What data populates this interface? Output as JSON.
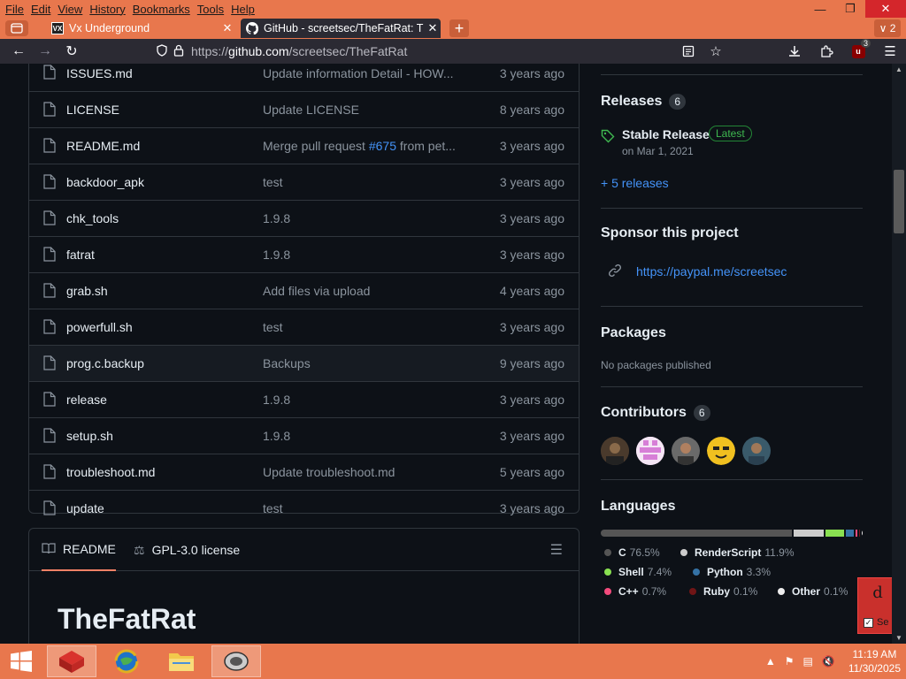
{
  "menubar": {
    "items": [
      "File",
      "Edit",
      "View",
      "History",
      "Bookmarks",
      "Tools",
      "Help"
    ]
  },
  "tabs": [
    {
      "title": "Vx Underground",
      "icon": "vx-favicon",
      "favicon_text": "VX"
    },
    {
      "title": "GitHub - screetsec/TheFatRat: T",
      "icon": "github-icon"
    }
  ],
  "tab_count": "2",
  "url": {
    "prefix": "https://",
    "domain": "github.com",
    "path": "/screetsec/TheFatRat"
  },
  "extension_badge": "3",
  "ublock_label": "u",
  "files": [
    {
      "name": "ISSUES.md",
      "message": "Update information Detail - HOW...",
      "time": "3 years ago"
    },
    {
      "name": "LICENSE",
      "message": "Update LICENSE",
      "time": "8 years ago"
    },
    {
      "name": "README.md",
      "message": "Merge pull request ",
      "pr": "#675",
      "message_tail": " from pet...",
      "time": "3 years ago"
    },
    {
      "name": "backdoor_apk",
      "message": "test",
      "time": "3 years ago"
    },
    {
      "name": "chk_tools",
      "message": "1.9.8",
      "time": "3 years ago"
    },
    {
      "name": "fatrat",
      "message": "1.9.8",
      "time": "3 years ago"
    },
    {
      "name": "grab.sh",
      "message": "Add files via upload",
      "time": "4 years ago"
    },
    {
      "name": "powerfull.sh",
      "message": "test",
      "time": "3 years ago"
    },
    {
      "name": "prog.c.backup",
      "message": "Backups",
      "time": "9 years ago"
    },
    {
      "name": "release",
      "message": "1.9.8",
      "time": "3 years ago"
    },
    {
      "name": "setup.sh",
      "message": "1.9.8",
      "time": "3 years ago"
    },
    {
      "name": "troubleshoot.md",
      "message": "Update troubleshoot.md",
      "time": "5 years ago"
    },
    {
      "name": "update",
      "message": "test",
      "time": "3 years ago"
    }
  ],
  "readme": {
    "tab_readme": "README",
    "tab_license": "GPL-3.0 license",
    "title": "TheFatRat"
  },
  "sidebar": {
    "releases": {
      "heading": "Releases",
      "count": "6",
      "name": "Stable Release",
      "badge": "Latest",
      "date": "on Mar 1, 2021",
      "more": "+ 5 releases"
    },
    "sponsor": {
      "heading": "Sponsor this project",
      "link": "https://paypal.me/screetsec"
    },
    "packages": {
      "heading": "Packages",
      "note": "No packages published"
    },
    "contributors": {
      "heading": "Contributors",
      "count": "6"
    },
    "languages": {
      "heading": "Languages",
      "items": [
        {
          "name": "C",
          "pct": "76.5%",
          "color": "#555555",
          "value": 76.5
        },
        {
          "name": "RenderScript",
          "pct": "11.9%",
          "color": "#cccccc",
          "value": 11.9
        },
        {
          "name": "Shell",
          "pct": "7.4%",
          "color": "#89e051",
          "value": 7.4
        },
        {
          "name": "Python",
          "pct": "3.3%",
          "color": "#3572A5",
          "value": 3.3
        },
        {
          "name": "C++",
          "pct": "0.7%",
          "color": "#f34b7d",
          "value": 0.7
        },
        {
          "name": "Ruby",
          "pct": "0.1%",
          "color": "#701516",
          "value": 0.1
        },
        {
          "name": "Other",
          "pct": "0.1%",
          "color": "#ededed",
          "value": 0.1
        }
      ]
    }
  },
  "overlay": {
    "letter": "d",
    "checkbox_label": "Se"
  },
  "taskbar": {
    "time": "11:19 AM",
    "date": "11/30/2025"
  },
  "colors": {
    "taskbar": "#e8774d",
    "accent_link": "#4493f8",
    "latest_green": "#3fb950"
  }
}
